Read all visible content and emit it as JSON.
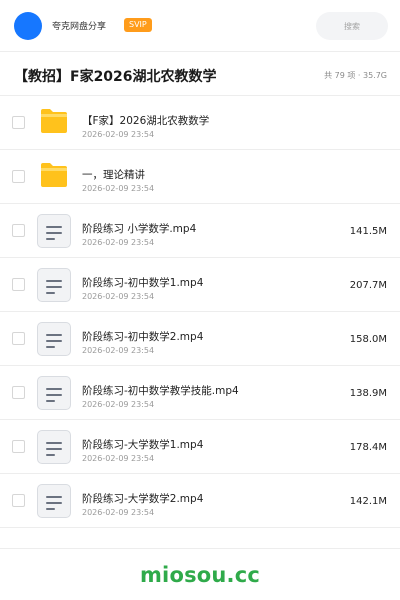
{
  "header": {
    "user_name": "夸克网盘分享",
    "badge": "SVIP",
    "search_placeholder": "搜索"
  },
  "title_bar": {
    "title": "【教招】F家2026湖北农教数学",
    "summary": "共 79 项 · 35.7G"
  },
  "files": [
    {
      "type": "folder",
      "icon": "folder-icon",
      "name": "【F家】2026湖北农教数学",
      "date": "2026-02-09 23:54",
      "size": ""
    },
    {
      "type": "folder",
      "icon": "folder-icon",
      "name": "一，理论精讲",
      "date": "2026-02-09 23:54",
      "size": ""
    },
    {
      "type": "file",
      "icon": "document-icon",
      "name": "阶段练习 小学数学.mp4",
      "date": "2026-02-09 23:54",
      "size": "141.5M"
    },
    {
      "type": "file",
      "icon": "document-icon",
      "name": "阶段练习-初中数学1.mp4",
      "date": "2026-02-09 23:54",
      "size": "207.7M"
    },
    {
      "type": "file",
      "icon": "document-icon",
      "name": "阶段练习-初中数学2.mp4",
      "date": "2026-02-09 23:54",
      "size": "158.0M"
    },
    {
      "type": "file",
      "icon": "document-icon",
      "name": "阶段练习-初中数学教学技能.mp4",
      "date": "2026-02-09 23:54",
      "size": "138.9M"
    },
    {
      "type": "file",
      "icon": "document-icon",
      "name": "阶段练习-大学数学1.mp4",
      "date": "2026-02-09 23:54",
      "size": "178.4M"
    },
    {
      "type": "file",
      "icon": "document-icon",
      "name": "阶段练习-大学数学2.mp4",
      "date": "2026-02-09 23:54",
      "size": "142.1M"
    }
  ],
  "footer": {
    "watermark": "miosou.cc"
  },
  "colors": {
    "accent_blue": "#1677ff",
    "svip_orange": "#ff9c1b",
    "folder_yellow": "#ffc21c",
    "watermark_green": "#2faa4a"
  }
}
